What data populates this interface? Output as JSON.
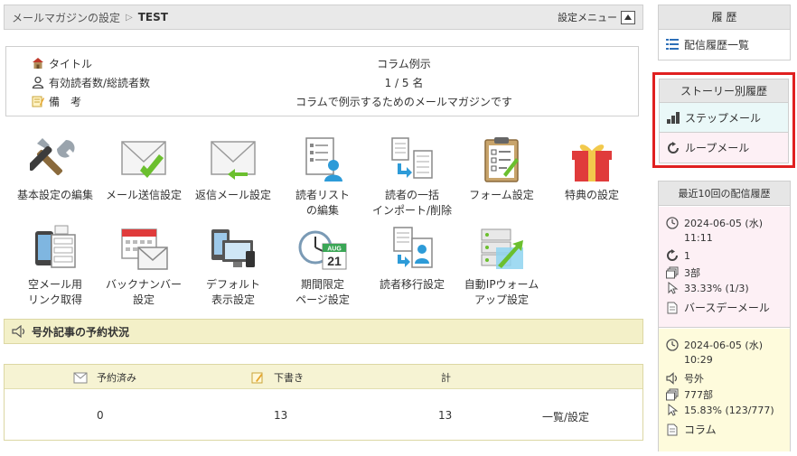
{
  "header": {
    "breadcrumb_parent": "メールマガジンの設定",
    "breadcrumb_sep": "▷",
    "breadcrumb_current": "TEST",
    "menu_label": "設定メニュー"
  },
  "info": {
    "title_label": "タイトル",
    "title_value": "コラム例示",
    "readers_label": "有効読者数/総読者数",
    "readers_value": "1 / 5 名",
    "note_label": "備　考",
    "note_value": "コラムで例示するためのメールマガジンです"
  },
  "tiles": [
    {
      "line1": "基本設定の編集",
      "line2": ""
    },
    {
      "line1": "メール送信設定",
      "line2": ""
    },
    {
      "line1": "返信メール設定",
      "line2": ""
    },
    {
      "line1": "読者リスト",
      "line2": "の編集"
    },
    {
      "line1": "読者の一括",
      "line2": "インポート/削除"
    },
    {
      "line1": "フォーム設定",
      "line2": ""
    },
    {
      "line1": "特典の設定",
      "line2": ""
    },
    {
      "line1": "空メール用",
      "line2": "リンク取得"
    },
    {
      "line1": "バックナンバー",
      "line2": "設定"
    },
    {
      "line1": "デフォルト",
      "line2": "表示設定"
    },
    {
      "line1": "期間限定",
      "line2": "ページ設定"
    },
    {
      "line1": "読者移行設定",
      "line2": ""
    },
    {
      "line1": "自動IPウォーム",
      "line2": "アップ設定"
    }
  ],
  "calendar_icon": {
    "month": "AUG",
    "day": "21"
  },
  "section": {
    "title": "号外記事の予約状況"
  },
  "reservations": {
    "headers": {
      "reserved": "予約済み",
      "draft": "下書き",
      "total": "計"
    },
    "values": {
      "reserved": "0",
      "draft": "13",
      "total": "13"
    },
    "link": "一覧/設定"
  },
  "sidebar": {
    "history": {
      "title": "履 歴",
      "item": "配信履歴一覧"
    },
    "story": {
      "title": "ストーリー別履歴",
      "step": "ステップメール",
      "loop": "ループメール"
    },
    "recent": {
      "title": "最近10回の配信履歴",
      "entries": [
        {
          "date": "2024-06-05 (水)",
          "time": "11:11",
          "kind": "1",
          "count": "3部",
          "rate": "33.33% (1/3)",
          "subject": "バースデーメール"
        },
        {
          "date": "2024-06-05 (水)",
          "time": "10:29",
          "kind": "号外",
          "count": "777部",
          "rate": "15.83% (123/777)",
          "subject": "コラム"
        }
      ]
    }
  },
  "colors": {
    "highlight_red": "#e02020",
    "yellow_bar": "#f3f0c8",
    "pink_bg": "#fdf0f5",
    "cyan_bg": "#eaf8f8",
    "green_check": "#6bbf2e"
  }
}
